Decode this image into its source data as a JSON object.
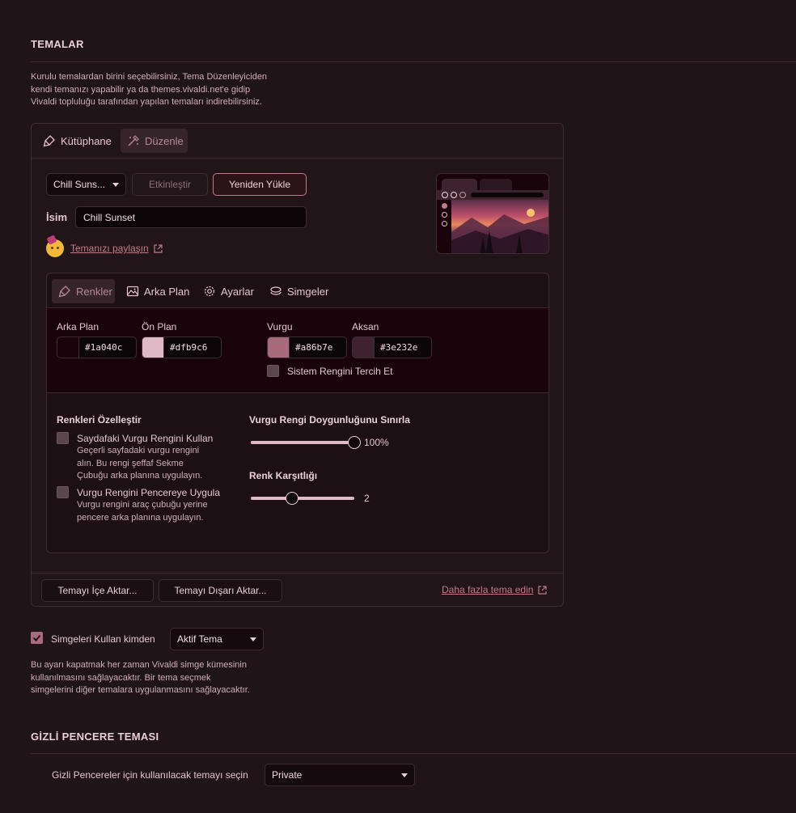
{
  "themes": {
    "title": "TEMALAR",
    "description_lines": [
      "Kurulu temalardan birini seçebilirsiniz, Tema Düzenleyiciden",
      "kendi temanızı yapabilir ya da themes.vivaldi.net'e gidip",
      "Vivaldi topluluğu tarafından yapılan temaları indirebilirsiniz."
    ]
  },
  "tabs": {
    "library": "Kütüphane",
    "edit": "Düzenle"
  },
  "editor": {
    "theme_select": "Chill Suns...",
    "activate": "Etkinleştir",
    "reload": "Yeniden Yükle",
    "name_label": "İsim",
    "name_value": "Chill Sunset",
    "share_link": "Temanızı paylaşın"
  },
  "subtabs": {
    "colors": "Renkler",
    "background": "Arka Plan",
    "settings": "Ayarlar",
    "icons": "Simgeler"
  },
  "colors": {
    "bg_label": "Arka Plan",
    "bg_hex": "#1a040c",
    "fg_label": "Ön Plan",
    "fg_hex": "#dfb9c6",
    "highlight_label": "Vurgu",
    "highlight_hex": "#a86b7e",
    "accent_label": "Aksan",
    "accent_hex": "#3e232e",
    "prefer_system": "Sistem Rengini Tercih Et"
  },
  "customize": {
    "title": "Renkleri Özelleştir",
    "opt1_title": "Saydafaki Vurgu Rengini Kullan",
    "opt1_desc_lines": [
      "Geçerli sayfadaki vurgu rengini",
      "alın. Bu rengi şeffaf Sekme",
      "Çubuğu arka planına uygulayın."
    ],
    "opt2_title": "Vurgu Rengini Pencereye Uygula",
    "opt2_desc_lines": [
      "Vurgu rengini araç çubuğu yerine",
      "pencere arka planına uygulayın."
    ],
    "saturation_title": "Vurgu Rengi Doygunluğunu Sınırla",
    "saturation_value": "100%",
    "saturation_level": 1.0,
    "contrast_title": "Renk Karşıtlığı",
    "contrast_value": "2",
    "contrast_level": 0.4
  },
  "footer_buttons": {
    "import": "Temayı İçe Aktar...",
    "export": "Temayı Dışarı Aktar...",
    "more": "Daha fazla tema edin"
  },
  "icons_from": {
    "label": "Simgeleri Kullan kimden",
    "select": "Aktif Tema",
    "desc_lines": [
      "Bu ayarı kapatmak her zaman Vivaldi simge kümesinin",
      "kullanılmasını sağlayacaktır. Bir tema seçmek",
      "simgelerini diğer temalara uygulanmasını sağlayacaktır."
    ]
  },
  "private": {
    "title": "GİZLİ PENCERE TEMASI",
    "label": "Gizli Pencereler için kullanılacak temayı seçin",
    "select": "Private"
  },
  "palette": {
    "background": "#1a040c",
    "foreground": "#dfb9c6",
    "highlight": "#a86b7e",
    "accent": "#3e232e"
  }
}
